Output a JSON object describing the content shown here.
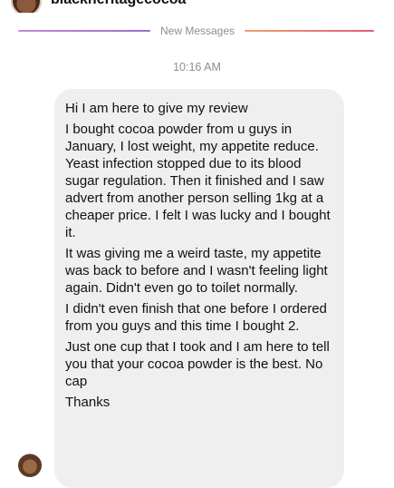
{
  "header": {
    "username": "blackheritagecocoa"
  },
  "new_messages_label": "New Messages",
  "timestamp": "10:16 AM",
  "message": {
    "paragraphs": [
      "Hi I am here to give my review",
      "I bought cocoa powder from u guys in January, I lost weight, my appetite reduce. Yeast infection stopped due to its blood sugar regulation. Then it finished and I saw advert from another person selling 1kg at a cheaper price. I felt I was lucky and I bought it.",
      "It was giving me a weird taste, my appetite was back to before and I wasn't feeling light again. Didn't even go to toilet normally.",
      "I didn't even finish that one before I ordered from you guys and this time I bought 2.",
      "Just one cup that I took and I am here to tell you that your cocoa powder is the best. No cap",
      "Thanks"
    ]
  }
}
